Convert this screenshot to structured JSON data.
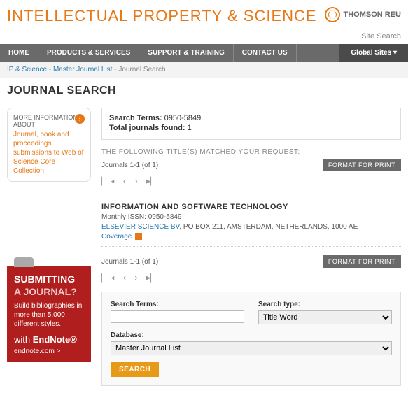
{
  "header": {
    "title": "INTELLECTUAL PROPERTY & SCIENCE",
    "brand": "THOMSON REU",
    "site_search": "Site Search"
  },
  "nav": {
    "home": "HOME",
    "products": "PRODUCTS & SERVICES",
    "support": "SUPPORT & TRAINING",
    "contact": "CONTACT US",
    "global": "Global Sites ▾"
  },
  "breadcrumb": {
    "ip": "IP & Science",
    "master": "Master Journal List",
    "current": "Journal Search",
    "sep": " - "
  },
  "page_title": "JOURNAL SEARCH",
  "sidebar": {
    "info_label": "MORE INFORMATION ABOUT",
    "info_link": "Journal, book and proceedings submissions to Web of Science Core Collection",
    "promo": {
      "title": "SUBMITTING",
      "sub": "A JOURNAL?",
      "text": "Build bibliographies in more than 5,000 different styles.",
      "with": "with",
      "endnote": "EndNote®",
      "url": "endnote.com  >"
    }
  },
  "results": {
    "terms_label": "Search Terms:",
    "terms_value": "0950-5849",
    "total_label": "Total journals found:",
    "total_value": "1",
    "match_label": "THE FOLLOWING TITLE(S) MATCHED YOUR REQUEST:",
    "pager": "Journals 1-1 (of 1)",
    "format_print": "FORMAT FOR PRINT"
  },
  "journal": {
    "title": "INFORMATION AND SOFTWARE TECHNOLOGY",
    "issn": "Monthly ISSN: 0950-5849",
    "publisher": "ELSEVIER SCIENCE BV",
    "address": ", PO BOX 211, AMSTERDAM, NETHERLANDS, 1000 AE",
    "coverage": "Coverage"
  },
  "search": {
    "terms_label": "Search Terms:",
    "type_label": "Search type:",
    "type_value": "Title Word",
    "db_label": "Database:",
    "db_value": "Master Journal List",
    "button": "SEARCH"
  }
}
